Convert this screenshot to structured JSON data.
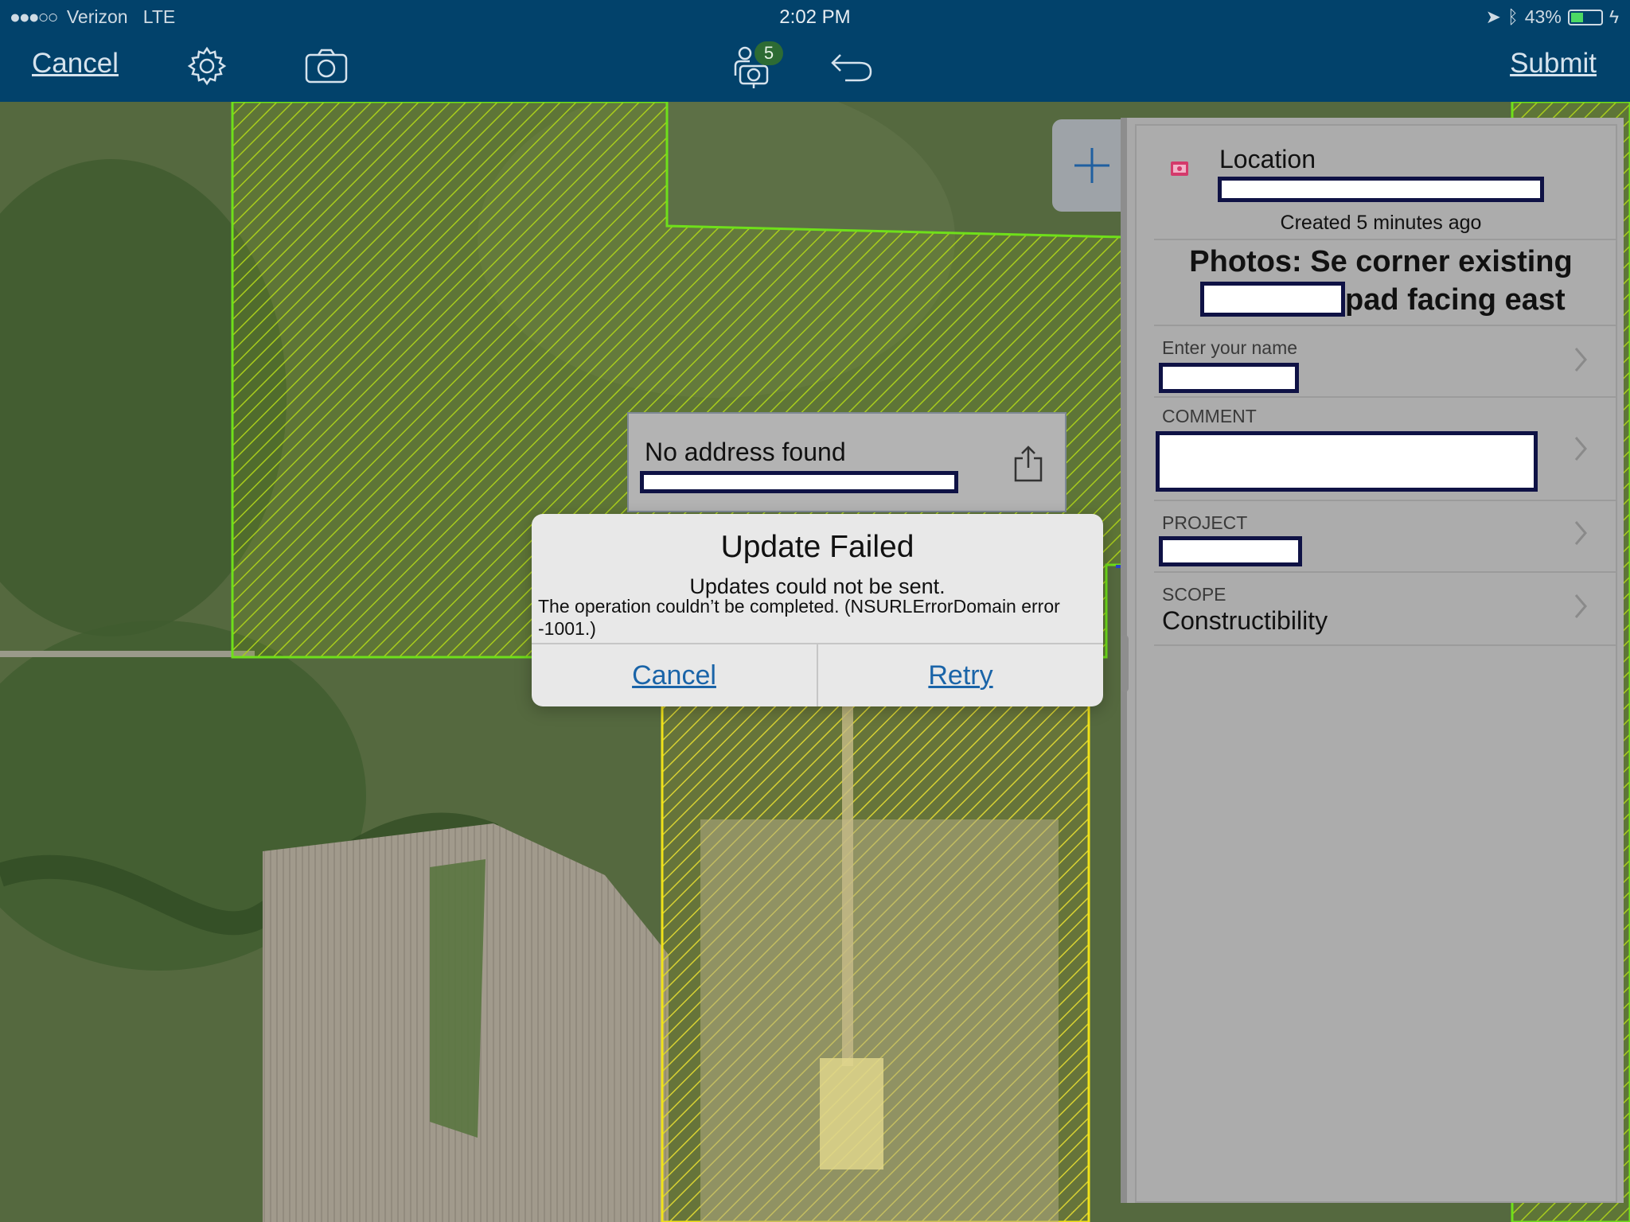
{
  "status_bar": {
    "carrier": "Verizon",
    "network": "LTE",
    "time": "2:02 PM",
    "battery": "43%",
    "battery_level": 0.43
  },
  "toolbar": {
    "cancel_label": "Cancel",
    "submit_label": "Submit",
    "collector_badge": "5"
  },
  "address_callout": {
    "text": "No address found"
  },
  "alert": {
    "title": "Update Failed",
    "message": "Updates could not be sent.",
    "detail_line1": "The operation couldn’t be completed. (NSURLErrorDomain error",
    "detail_line2": "-1001.)",
    "cancel_label": "Cancel",
    "retry_label": "Retry"
  },
  "panel": {
    "location_label": "Location",
    "created": "Created 5 minutes ago",
    "photo_title_line1": "Photos: Se corner existing",
    "photo_title_line2": "pad facing east",
    "fields": {
      "name_label": "Enter your name",
      "comment_label": "COMMENT",
      "project_label": "PROJECT",
      "scope_label": "SCOPE",
      "scope_value": "Constructibility"
    }
  },
  "colors": {
    "toolbar_bg": "#02426b",
    "link_blue": "#1a64a8",
    "hatch_green": "#9bc41b",
    "hatch_yellow": "#d7cf2a"
  }
}
